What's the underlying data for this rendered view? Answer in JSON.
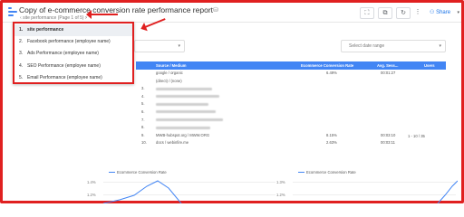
{
  "report": {
    "title": "Copy of e-commerce conversion rate performance report",
    "pager": "site performance (Page 1 of 5)",
    "pager_chevron": "›"
  },
  "toolbar": {
    "share_label": "Share",
    "share_icon": "person-add-icon",
    "buttons": [
      "fullscreen-icon",
      "open-in-new-icon",
      "refresh-icon",
      "more-vert-icon"
    ]
  },
  "pages_menu": {
    "items": [
      {
        "num": "1.",
        "label": "site performance",
        "selected": true
      },
      {
        "num": "2.",
        "label": "Facebook performance (employee name)"
      },
      {
        "num": "3.",
        "label": "Ads Performance (employee name)"
      },
      {
        "num": "4.",
        "label": "SEO Performance (employee name)"
      },
      {
        "num": "5.",
        "label": "Email Performance (employee name)"
      }
    ]
  },
  "filters": {
    "date_range_label": "Select date range"
  },
  "table": {
    "headers": [
      "Source / Medium",
      "Ecommerce Conversion Rate",
      "Avg. Sess...",
      "Users"
    ],
    "rows": [
      {
        "n": "",
        "source": "google / organic",
        "rate": "6.49%",
        "sess": "00:01:27",
        "users": ""
      },
      {
        "n": "",
        "source": "(direct) / (none)",
        "rate": "",
        "sess": "",
        "users": ""
      },
      {
        "n": "3.",
        "source": "",
        "rate": "",
        "sess": "",
        "users": ""
      },
      {
        "n": "4.",
        "source": "",
        "rate": "",
        "sess": "",
        "users": ""
      },
      {
        "n": "5.",
        "source": "",
        "rate": "",
        "sess": "",
        "users": ""
      },
      {
        "n": "6.",
        "source": "",
        "rate": "",
        "sess": "",
        "users": ""
      },
      {
        "n": "7.",
        "source": "",
        "rate": "",
        "sess": "",
        "users": ""
      },
      {
        "n": "8.",
        "source": "",
        "rate": "",
        "sess": "",
        "users": ""
      },
      {
        "n": "9.",
        "source": "MWB-hubspot.org / MWW.ORG",
        "rate": "8.15%",
        "sess": "00:03:10",
        "users": ""
      },
      {
        "n": "10.",
        "source": "docs / webinfire.me",
        "rate": "2.63%",
        "sess": "00:03:11",
        "users": ""
      }
    ],
    "pagination": "1 - 10 / 35"
  },
  "charts": {
    "left": {
      "legend": "Ecommerce Conversion Rate",
      "ytick_top": "1.4%",
      "ytick_bottom": "1.2%"
    },
    "right": {
      "legend": "Ecommerce Conversion Rate",
      "ytick_top": "1.3%",
      "ytick_bottom": "1.2%"
    }
  },
  "colors": {
    "accent": "#4285f4",
    "annotation": "#e02020"
  }
}
